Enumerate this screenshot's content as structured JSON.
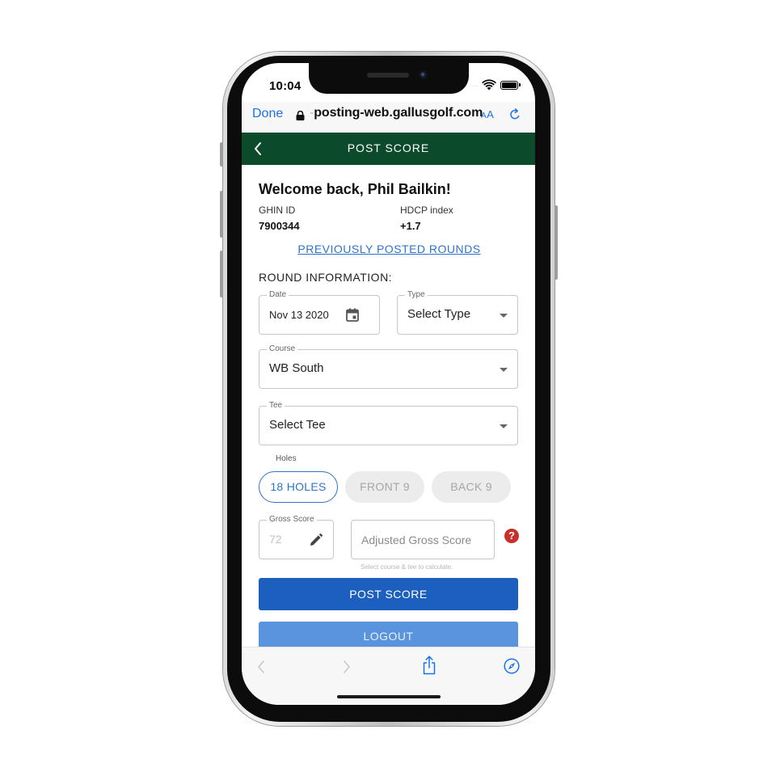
{
  "status_bar": {
    "time": "10:04",
    "signal": "....",
    "icons": [
      "wifi-icon",
      "battery-icon"
    ]
  },
  "safari": {
    "done_label": "Done",
    "url_prefix": "-",
    "url": "posting-web.gallusgolf.com",
    "text_size_label_small": "A",
    "text_size_label_large": "A",
    "icons": [
      "lock-icon",
      "reload-icon"
    ]
  },
  "header": {
    "title": "POST SCORE",
    "back_icon": "chevron-left-icon",
    "background": "#0b4a2a"
  },
  "user": {
    "welcome": "Welcome back, Phil Bailkin!",
    "ghin_label": "GHIN ID",
    "ghin_value": "7900344",
    "hdcp_label": "HDCP index",
    "hdcp_value": "+1.7"
  },
  "links": {
    "previously_posted": "PREVIOUSLY POSTED ROUNDS"
  },
  "round": {
    "section_title": "ROUND INFORMATION:",
    "date": {
      "label": "Date",
      "value": "Nov 13 2020",
      "icon": "calendar-icon"
    },
    "type": {
      "label": "Type",
      "value": "Select Type"
    },
    "course": {
      "label": "Course",
      "value": "WB South"
    },
    "tee": {
      "label": "Tee",
      "value": "Select Tee"
    },
    "holes": {
      "label": "Holes",
      "options": [
        "18 HOLES",
        "FRONT 9",
        "BACK 9"
      ],
      "selected": "18 HOLES"
    },
    "gross_score": {
      "label": "Gross Score",
      "placeholder": "72",
      "icon": "pencil-icon"
    },
    "adjusted_gross_score": {
      "placeholder": "Adjusted Gross Score",
      "hint": "Select course & tee to calculate.",
      "help_symbol": "?"
    }
  },
  "actions": {
    "post_score": "POST SCORE",
    "logout": "LOGOUT"
  },
  "toolbar": {
    "icons": [
      "back-arrow-icon",
      "forward-arrow-icon",
      "share-icon",
      "compass-icon"
    ]
  },
  "colors": {
    "accent": "#2e74c8",
    "primary_button": "#1d5fbf",
    "secondary_button": "#5a93de",
    "help": "#c9302c"
  }
}
